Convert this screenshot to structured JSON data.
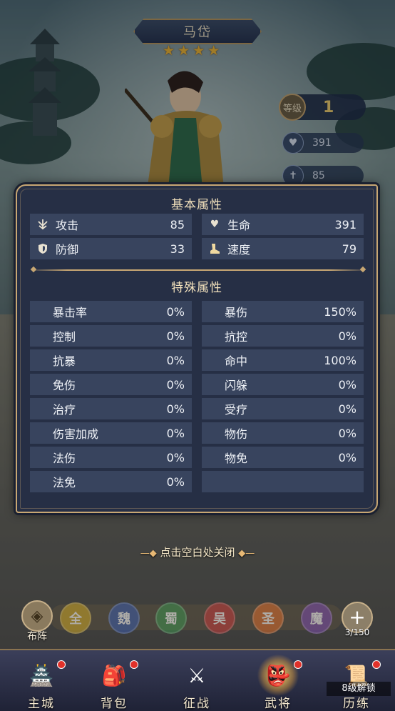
{
  "hero": {
    "name": "马岱",
    "stars": [
      "★",
      "★",
      "★",
      "★"
    ],
    "level_label": "等级",
    "level": "1",
    "hp": "391",
    "atk": "85"
  },
  "basic": {
    "title": "基本属性",
    "items": [
      {
        "label": "攻击",
        "value": "85",
        "icon": "attack-icon"
      },
      {
        "label": "生命",
        "value": "391",
        "icon": "heart-icon"
      },
      {
        "label": "防御",
        "value": "33",
        "icon": "shield-icon"
      },
      {
        "label": "速度",
        "value": "79",
        "icon": "boot-icon"
      }
    ]
  },
  "special": {
    "title": "特殊属性",
    "items": [
      {
        "label": "暴击率",
        "value": "0%"
      },
      {
        "label": "暴伤",
        "value": "150%"
      },
      {
        "label": "控制",
        "value": "0%"
      },
      {
        "label": "抗控",
        "value": "0%"
      },
      {
        "label": "抗暴",
        "value": "0%"
      },
      {
        "label": "命中",
        "value": "100%"
      },
      {
        "label": "免伤",
        "value": "0%"
      },
      {
        "label": "闪躲",
        "value": "0%"
      },
      {
        "label": "治疗",
        "value": "0%"
      },
      {
        "label": "受疗",
        "value": "0%"
      },
      {
        "label": "伤害加成",
        "value": "0%"
      },
      {
        "label": "物伤",
        "value": "0%"
      },
      {
        "label": "法伤",
        "value": "0%"
      },
      {
        "label": "物免",
        "value": "0%"
      },
      {
        "label": "法免",
        "value": "0%"
      }
    ]
  },
  "close_hint": {
    "left_deco": "—◆",
    "text": "点击空白处关闭",
    "right_deco": "◆—"
  },
  "factions": {
    "formation_label": "布阵",
    "items": [
      {
        "label": "全",
        "color": "#c9a326"
      },
      {
        "label": "魏",
        "color": "#3a5aa8"
      },
      {
        "label": "蜀",
        "color": "#3d8f4e"
      },
      {
        "label": "吴",
        "color": "#c23a3a"
      },
      {
        "label": "圣",
        "color": "#d86a2a"
      },
      {
        "label": "魔",
        "color": "#7a4aa8"
      }
    ],
    "plus_glyph": "+",
    "count": "3/150"
  },
  "nav": {
    "items": [
      {
        "label": "主城",
        "glyph": "🏯",
        "badge": true
      },
      {
        "label": "背包",
        "glyph": "🎒",
        "badge": true
      },
      {
        "label": "征战",
        "glyph": "⚔",
        "badge": false
      },
      {
        "label": "武将",
        "glyph": "👺",
        "badge": true
      },
      {
        "label": "历练",
        "glyph": "📜",
        "badge": true
      }
    ],
    "unlock_text": "8级解锁"
  },
  "colors": {
    "panel_bg": "#262f45",
    "cell_bg": "#38445e",
    "gold": "#c8a773",
    "star": "#f2b630"
  }
}
